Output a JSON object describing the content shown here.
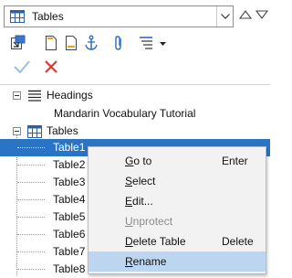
{
  "navigator": {
    "category_dropdown": {
      "selected": "Tables"
    },
    "tree": {
      "headings": {
        "label": "Headings",
        "children": [
          "Mandarin Vocabulary Tutorial"
        ]
      },
      "tables": {
        "label": "Tables",
        "children": [
          "Table1",
          "Table2",
          "Table3",
          "Table4",
          "Table5",
          "Table6",
          "Table7",
          "Table8"
        ]
      },
      "selected_item": "Table1"
    }
  },
  "context_menu": {
    "items": [
      {
        "mnemonic": "G",
        "rest": "o to",
        "shortcut": "Enter",
        "enabled": true
      },
      {
        "mnemonic": "S",
        "rest": "elect",
        "shortcut": "",
        "enabled": true
      },
      {
        "mnemonic": "E",
        "rest": "dit...",
        "shortcut": "",
        "enabled": true
      },
      {
        "mnemonic": "U",
        "rest": "nprotect",
        "shortcut": "",
        "enabled": false
      },
      {
        "mnemonic": "D",
        "rest": "elete Table",
        "shortcut": "Delete",
        "enabled": true
      },
      {
        "mnemonic": "R",
        "rest": "ename",
        "shortcut": "",
        "enabled": true,
        "highlighted": true
      }
    ]
  },
  "colors": {
    "selection": "#2a74c6",
    "menu_highlight": "#bcd6f0",
    "cancel_red": "#e03030",
    "ok_disabled": "#9bbfe0"
  }
}
